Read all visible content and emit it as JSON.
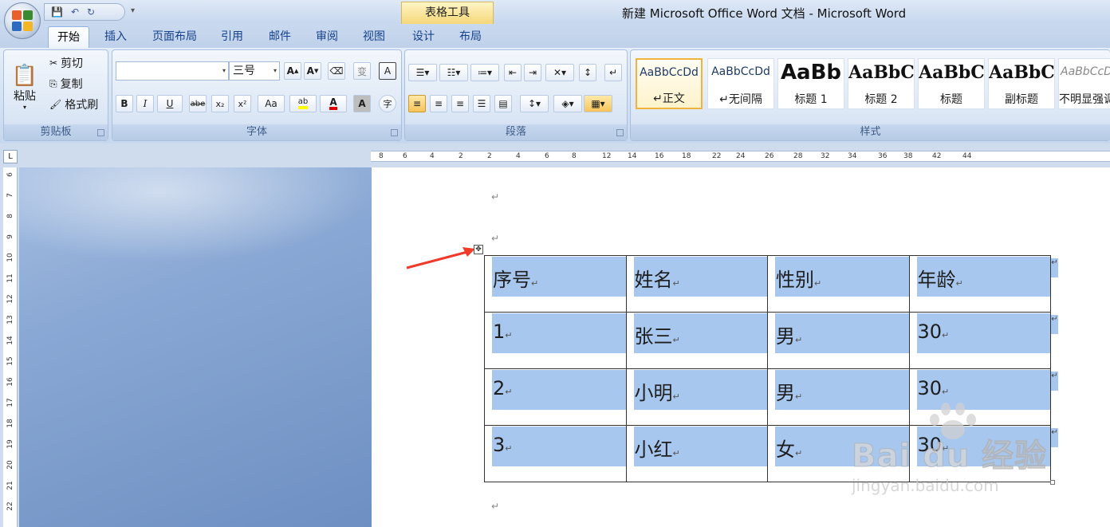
{
  "title_bar": {
    "window_title": "新建 Microsoft Office Word 文档 - Microsoft Word",
    "context_tool": "表格工具"
  },
  "tabs": [
    {
      "label": "开始",
      "active": true
    },
    {
      "label": "插入"
    },
    {
      "label": "页面布局"
    },
    {
      "label": "引用"
    },
    {
      "label": "邮件"
    },
    {
      "label": "审阅"
    },
    {
      "label": "视图"
    },
    {
      "label": "设计"
    },
    {
      "label": "布局"
    }
  ],
  "clipboard": {
    "group_label": "剪贴板",
    "paste": "粘贴",
    "cut": "剪切",
    "copy": "复制",
    "format_painter": "格式刷"
  },
  "font": {
    "group_label": "字体",
    "font_name": "",
    "font_size": "三号",
    "buttons": [
      "B",
      "I",
      "U",
      "abe",
      "x₂",
      "x²",
      "Aa"
    ],
    "clear_format": "变",
    "char_border": "A",
    "char_shade": "A",
    "circled": "字",
    "highlight_color": "#ffff00",
    "font_color": "#e00000"
  },
  "paragraph": {
    "group_label": "段落"
  },
  "styles": {
    "group_label": "样式",
    "items": [
      {
        "sample": "AaBbCcDd",
        "name": "↵正文",
        "selected": true
      },
      {
        "sample": "AaBbCcDd",
        "name": "↵无间隔"
      },
      {
        "sample": "AaBb",
        "name": "标题 1"
      },
      {
        "sample": "AaBbC",
        "name": "标题 2"
      },
      {
        "sample": "AaBbC",
        "name": "标题"
      },
      {
        "sample": "AaBbC",
        "name": "副标题"
      },
      {
        "sample": "AaBbCcD",
        "name": "不明显强调"
      }
    ]
  },
  "ruler": {
    "h_ticks": [
      "8",
      "6",
      "4",
      "2",
      "2",
      "4",
      "6",
      "8",
      "12",
      "14",
      "16",
      "18",
      "22",
      "24",
      "26",
      "28",
      "32",
      "34",
      "36",
      "38",
      "42",
      "44"
    ],
    "v_ticks": [
      "6",
      "7",
      "8",
      "9",
      "10",
      "11",
      "12",
      "13",
      "14",
      "15",
      "16",
      "17",
      "18",
      "19",
      "20",
      "21",
      "22"
    ]
  },
  "document": {
    "para_mark": "↵",
    "table": {
      "headers": [
        "序号",
        "姓名",
        "性别",
        "年龄"
      ],
      "rows": [
        [
          "1",
          "张三",
          "男",
          "30"
        ],
        [
          "2",
          "小明",
          "男",
          "30"
        ],
        [
          "3",
          "小红",
          "女",
          "30"
        ]
      ]
    }
  },
  "watermark": {
    "text": "Bai du 经验",
    "url": "jingyan.baidu.com"
  }
}
